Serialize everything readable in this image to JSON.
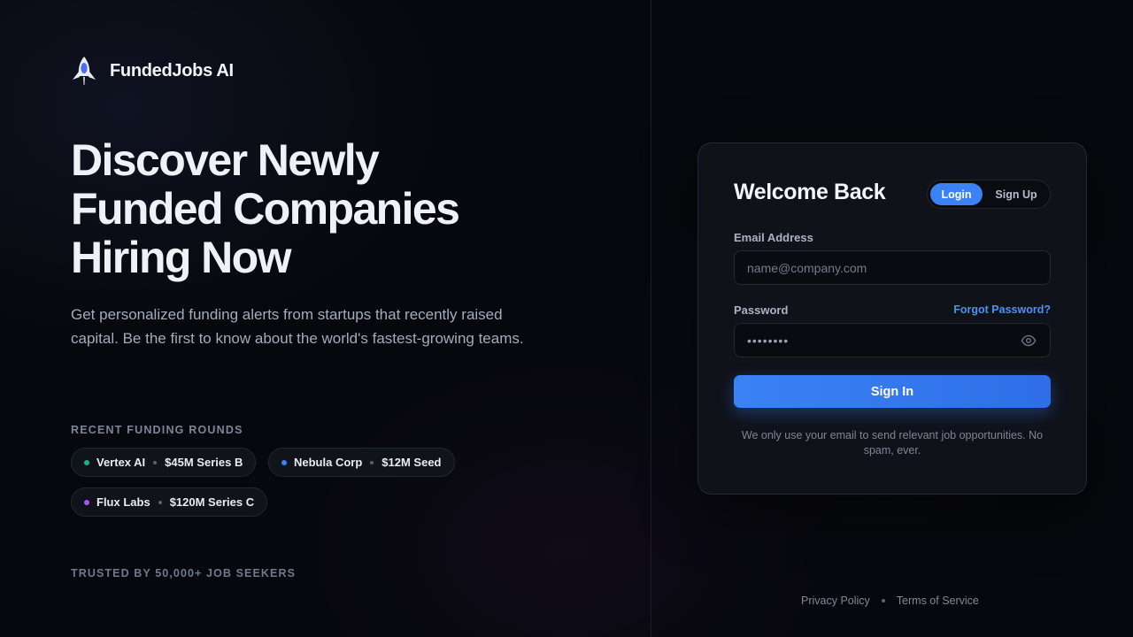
{
  "brand": {
    "name": "FundedJobs AI",
    "logo_icon": "rocket-icon"
  },
  "hero": {
    "title_lines": [
      "Discover Newly",
      "Funded Companies",
      "Hiring Now"
    ],
    "subtitle": "Get personalized funding alerts from startups that recently raised capital. Be the first to know about the world's fastest-growing teams."
  },
  "funding": {
    "label": "RECENT FUNDING ROUNDS",
    "rounds": [
      {
        "company": "Vertex AI",
        "amount": "$45M Series B",
        "dot_color": "#10b981"
      },
      {
        "company": "Nebula Corp",
        "amount": "$12M Seed",
        "dot_color": "#3b82f6"
      },
      {
        "company": "Flux Labs",
        "amount": "$120M Series C",
        "dot_color": "#a855f7"
      }
    ]
  },
  "trusted": "TRUSTED BY 50,000+ JOB SEEKERS",
  "auth": {
    "title": "Welcome Back",
    "tabs": {
      "login": "Login",
      "signup": "Sign Up",
      "active": "login"
    },
    "email": {
      "label": "Email Address",
      "placeholder": "name@company.com",
      "value": ""
    },
    "password": {
      "label": "Password",
      "value": "••••••••",
      "forgot": "Forgot Password?",
      "toggle_icon": "eye-icon"
    },
    "submit": "Sign In",
    "disclaimer": "We only use your email to send relevant job opportunities. No spam, ever."
  },
  "footer": {
    "privacy": "Privacy Policy",
    "terms": "Terms of Service"
  },
  "colors": {
    "accent": "#3b82f6",
    "background": "#07080d",
    "card": "#10121a"
  }
}
